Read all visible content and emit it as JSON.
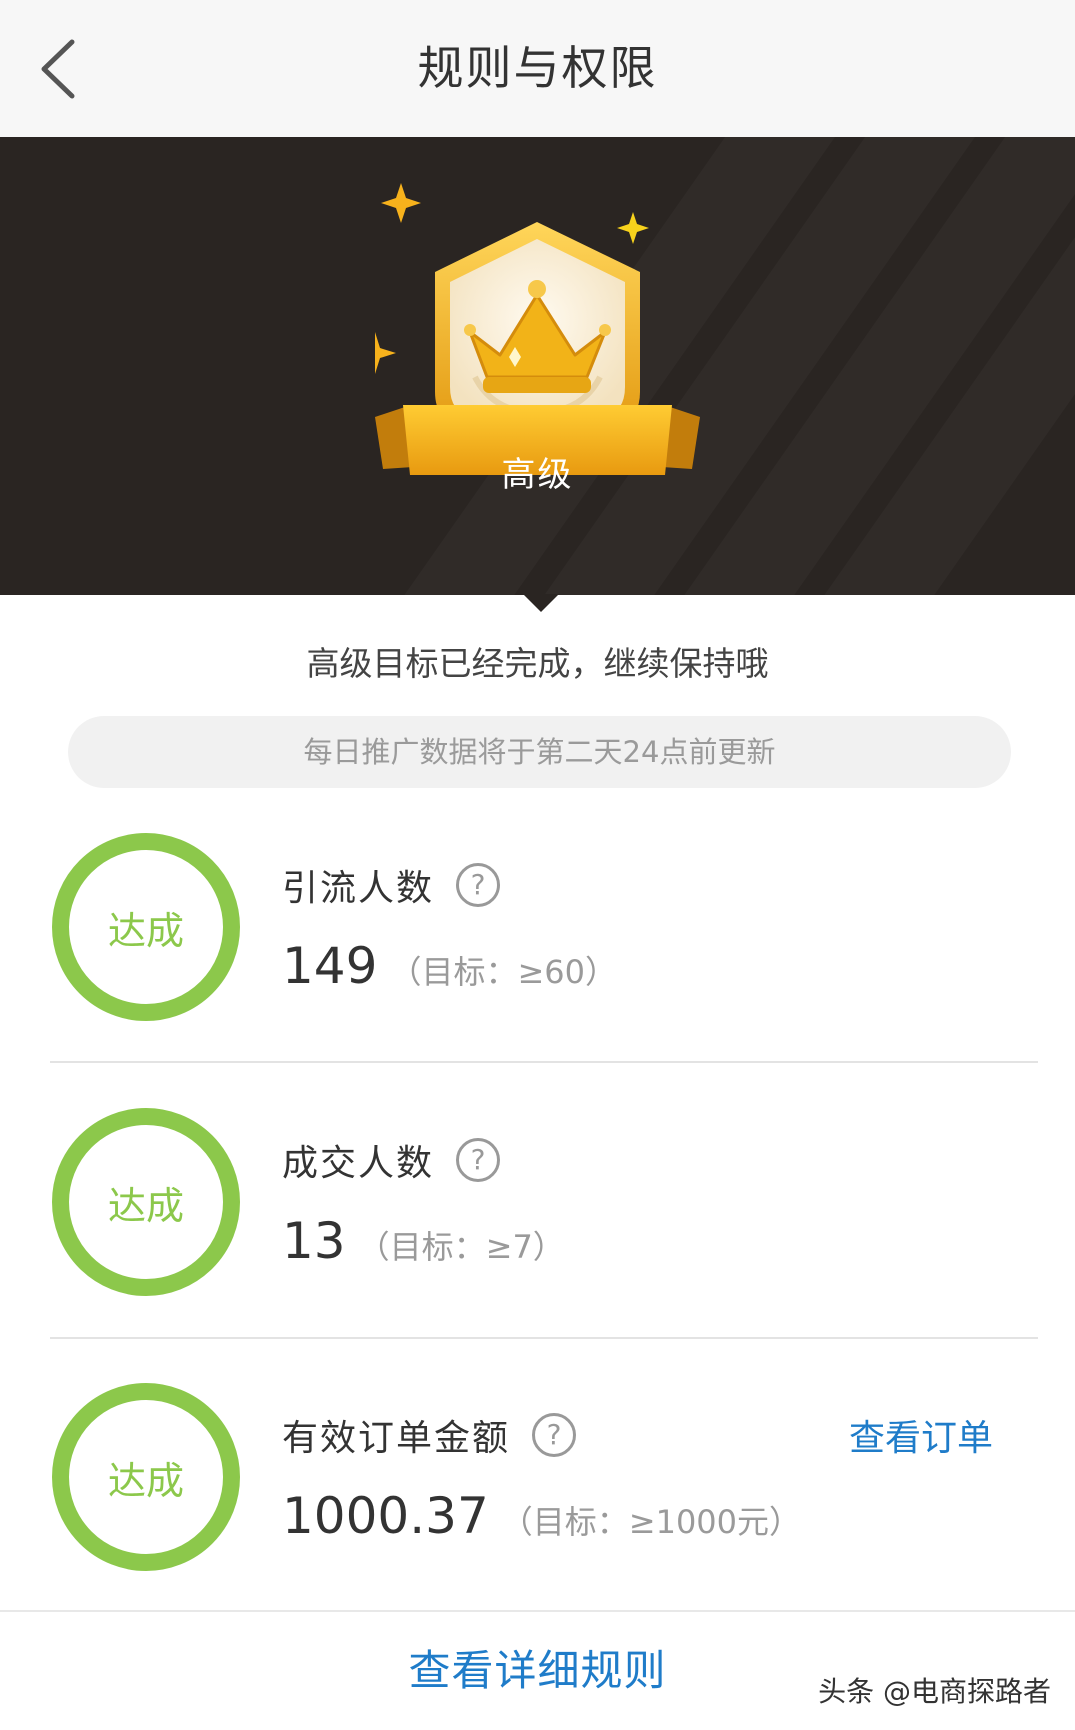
{
  "header": {
    "title": "规则与权限",
    "back_icon": "back-arrow-icon"
  },
  "badge": {
    "level": "高级",
    "icon": "crown-icon"
  },
  "status_text": "高级目标已经完成，继续保持哦",
  "notice": "每日推广数据将于第二天24点前更新",
  "metrics": [
    {
      "status": "达成",
      "label": "引流人数",
      "value": "149",
      "target": "（目标：≥60）"
    },
    {
      "status": "达成",
      "label": "成交人数",
      "value": "13",
      "target": "（目标：≥7）"
    },
    {
      "status": "达成",
      "label": "有效订单金额",
      "value": "1000.37",
      "target": "（目标：≥1000元）",
      "action": "查看订单"
    }
  ],
  "footer": {
    "detail_link": "查看详细规则"
  },
  "watermark": "头条 @电商探路者",
  "colors": {
    "accent_blue": "#1f7cc9",
    "success_green": "#8cc84b",
    "banner_bg": "#2a2522",
    "gold": "#f5b51a"
  }
}
